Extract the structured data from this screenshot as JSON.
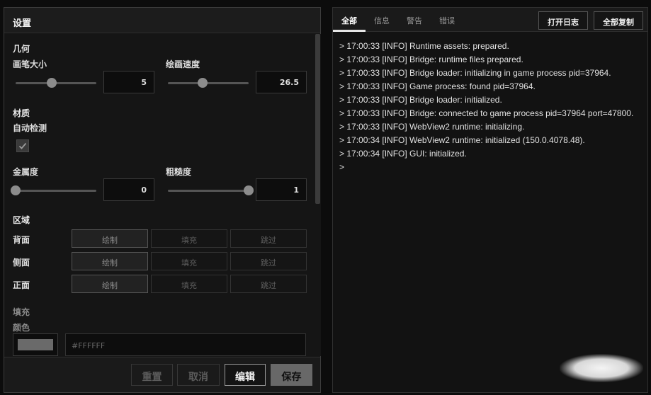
{
  "settings": {
    "title": "设置",
    "geometry": {
      "section": "几何",
      "brush_size": {
        "label": "画笔大小",
        "value": "5",
        "level": 0.45
      },
      "draw_speed": {
        "label": "绘画速度",
        "value": "26.5",
        "level": 0.43
      }
    },
    "material": {
      "section": "材质",
      "auto_detect": {
        "label": "自动检测",
        "checked": true
      },
      "metalness": {
        "label": "金属度",
        "value": "0",
        "level": 0.0
      },
      "roughness": {
        "label": "粗糙度",
        "value": "1",
        "level": 1.0
      }
    },
    "region": {
      "section": "区域",
      "rows": [
        {
          "label": "背面",
          "options": [
            "绘制",
            "填充",
            "跳过"
          ],
          "selected": 0
        },
        {
          "label": "侧面",
          "options": [
            "绘制",
            "填充",
            "跳过"
          ],
          "selected": 0
        },
        {
          "label": "正面",
          "options": [
            "绘制",
            "填充",
            "跳过"
          ],
          "selected": 0
        }
      ]
    },
    "fill": {
      "section": "填充",
      "color_label": "颜色",
      "color_value": "#FFFFFF",
      "swatch_color": "#6a6a6a"
    },
    "footer": {
      "reset": "重置",
      "cancel": "取消",
      "edit": "编辑",
      "save": "保存"
    }
  },
  "log_panel": {
    "tabs": [
      "全部",
      "信息",
      "警告",
      "错误"
    ],
    "active_tab": 0,
    "open_log": "打开日志",
    "copy_all": "全部复制",
    "lines": [
      "> 17:00:33 [INFO] Runtime assets: prepared.",
      "> 17:00:33 [INFO] Bridge: runtime files prepared.",
      "> 17:00:33 [INFO] Bridge loader: initializing in game process pid=37964.",
      "> 17:00:33 [INFO] Game process: found pid=37964.",
      "> 17:00:33 [INFO] Bridge loader: initialized.",
      "> 17:00:33 [INFO] Bridge: connected to game process pid=37964 port=47800.",
      "> 17:00:33 [INFO] WebView2 runtime: initializing.",
      "> 17:00:34 [INFO] WebView2 runtime: initialized (150.0.4078.48).",
      "> 17:00:34 [INFO] GUI: initialized.",
      ">"
    ]
  }
}
